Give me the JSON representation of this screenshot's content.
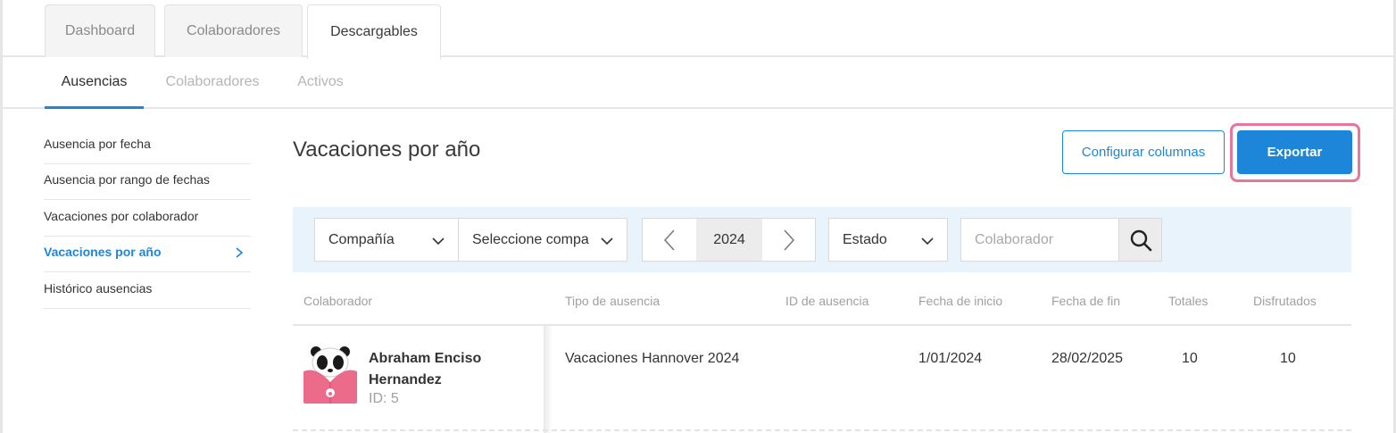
{
  "top_tabs": [
    {
      "label": "Dashboard"
    },
    {
      "label": "Colaboradores"
    },
    {
      "label": "Descargables"
    }
  ],
  "sub_tabs": [
    {
      "label": "Ausencias"
    },
    {
      "label": "Colaboradores"
    },
    {
      "label": "Activos"
    }
  ],
  "sidebar": {
    "items": [
      {
        "label": "Ausencia por fecha"
      },
      {
        "label": "Ausencia por rango de fechas"
      },
      {
        "label": "Vacaciones por colaborador"
      },
      {
        "label": "Vacaciones por año"
      },
      {
        "label": "Histórico ausencias"
      }
    ]
  },
  "page": {
    "title": "Vacaciones por año",
    "configure_label": "Configurar columnas",
    "export_label": "Exportar"
  },
  "filters": {
    "company_label": "Compañía",
    "company_value": "Seleccione compa",
    "year": "2024",
    "status_label": "Estado",
    "search_placeholder": "Colaborador"
  },
  "table": {
    "headers": [
      "Colaborador",
      "Tipo de ausencia",
      "ID de ausencia",
      "Fecha de inicio",
      "Fecha de fin",
      "Totales",
      "Disfrutados"
    ],
    "rows": [
      {
        "name": "Abraham Enciso Hernandez",
        "id_text": "ID: 5",
        "absence_type": "Vacaciones Hannover 2024",
        "absence_id": "",
        "start_date": "1/01/2024",
        "end_date": "28/02/2025",
        "total": "10",
        "enjoyed": "10"
      }
    ]
  },
  "colors": {
    "accent": "#1e86d8",
    "highlight": "#e8769a",
    "filter_bg": "#e9f3fb"
  }
}
